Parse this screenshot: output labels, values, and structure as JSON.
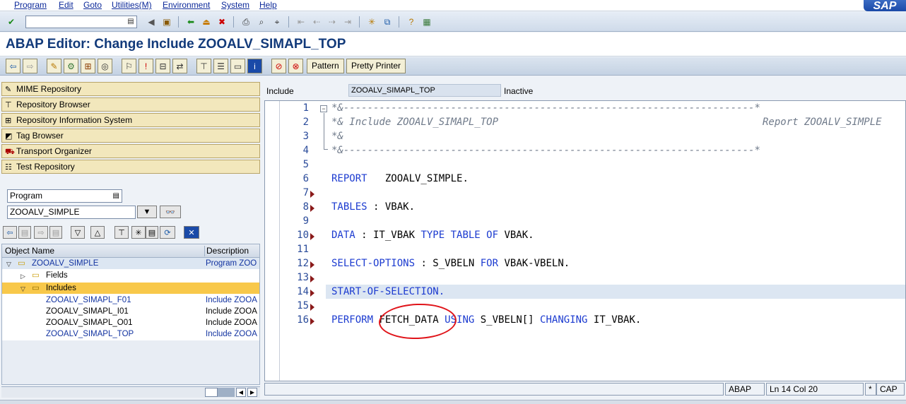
{
  "menu": [
    "Program",
    "Edit",
    "Goto",
    "Utilities(M)",
    "Environment",
    "System",
    "Help"
  ],
  "brand": "SAP",
  "command_field": {
    "value": ""
  },
  "title": "ABAP Editor: Change Include ZOOALV_SIMAPL_TOP",
  "app_toolbar": {
    "pattern_label": "Pattern",
    "pretty_printer_label": "Pretty Printer"
  },
  "nav": [
    {
      "label": "MIME Repository",
      "icon": "mime-icon"
    },
    {
      "label": "Repository Browser",
      "icon": "tree-icon"
    },
    {
      "label": "Repository Information System",
      "icon": "info-system-icon"
    },
    {
      "label": "Tag Browser",
      "icon": "tag-icon"
    },
    {
      "label": "Transport Organizer",
      "icon": "truck-icon"
    },
    {
      "label": "Test Repository",
      "icon": "test-icon"
    }
  ],
  "object_type": "Program",
  "object_name": "ZOOALV_SIMPLE",
  "tree": {
    "col_name": "Object Name",
    "col_desc": "Description",
    "rows": [
      {
        "name": "ZOOALV_SIMPLE",
        "desc": "Program ZOO",
        "level": 0
      },
      {
        "name": "Fields",
        "desc": "",
        "level": 1
      },
      {
        "name": "Includes",
        "desc": "",
        "level": 1
      },
      {
        "name": "ZOOALV_SIMAPL_F01",
        "desc": "Include ZOOA",
        "level": 2
      },
      {
        "name": "ZOOALV_SIMAPL_I01",
        "desc": "Include ZOOA",
        "level": 2
      },
      {
        "name": "ZOOALV_SIMAPL_O01",
        "desc": "Include ZOOA",
        "level": 2
      },
      {
        "name": "ZOOALV_SIMAPL_TOP",
        "desc": "Include ZOOA",
        "level": 2
      }
    ]
  },
  "editor": {
    "include_label": "Include",
    "include_name": "ZOOALV_SIMAPL_TOP",
    "state": "Inactive",
    "line_numbers": [
      "1",
      "2",
      "3",
      "4",
      "5",
      "6",
      "7",
      "8",
      "9",
      "10",
      "11",
      "12",
      "13",
      "14",
      "15",
      "16"
    ]
  },
  "code": {
    "l1": "*&---------------------------------------------------------------------*",
    "l2a": "*& Include ZOOALV_SIMAPL_TOP",
    "l2b": "Report ZOOALV_SIMPLE",
    "l3": "*&",
    "l4": "*&---------------------------------------------------------------------*",
    "l6_kw": "REPORT",
    "l6_rest": "   ZOOALV_SIMPLE.",
    "l8_kw": "TABLES",
    "l8_rest": " : VBAK.",
    "l10_kw1": "DATA",
    "l10_mid1": " : IT_VBAK ",
    "l10_kw2": "TYPE TABLE OF",
    "l10_rest": " VBAK.",
    "l12_kw1": "SELECT-OPTIONS",
    "l12_mid": " : S_VBELN ",
    "l12_kw2": "FOR",
    "l12_rest": " VBAK-VBELN.",
    "l14_kw": "START-OF-SELECTION.",
    "l16_kw1": "PERFORM",
    "l16_mid1": " FETCH_DATA ",
    "l16_kw2": "USING",
    "l16_mid2": " S_VBELN[] ",
    "l16_kw3": "CHANGING",
    "l16_rest": " IT_VBAK."
  },
  "status": {
    "lang": "ABAP",
    "position": "Ln 14 Col 20",
    "mod": "*",
    "caps": "CAP"
  }
}
